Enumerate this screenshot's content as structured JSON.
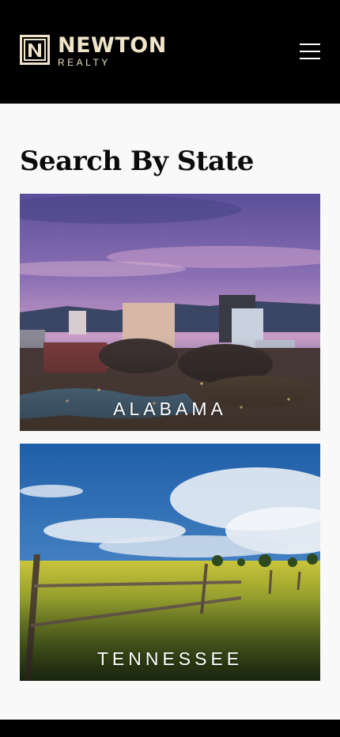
{
  "brand": {
    "name": "NEWTON",
    "sub": "REALTY",
    "color": "#efe3c8"
  },
  "header": {
    "menu_icon": "hamburger-menu-icon"
  },
  "main": {
    "title": "Search By State",
    "states": [
      {
        "label": "ALABAMA",
        "image": "city-skyline-dusk-image"
      },
      {
        "label": "TENNESSEE",
        "image": "field-fence-sky-image"
      }
    ]
  }
}
